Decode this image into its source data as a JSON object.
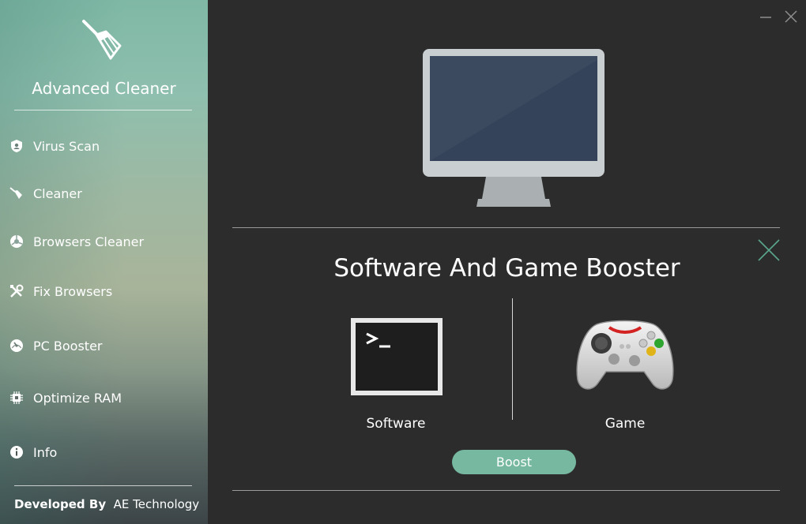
{
  "app": {
    "title": "Advanced Cleaner",
    "brand_icon": "broom-icon"
  },
  "sidebar": {
    "items": [
      {
        "label": "Virus Scan",
        "icon": "shield-icon"
      },
      {
        "label": "Cleaner",
        "icon": "broom-icon"
      },
      {
        "label": "Browsers Cleaner",
        "icon": "browser-icon"
      },
      {
        "label": "Fix Browsers",
        "icon": "tools-icon"
      },
      {
        "label": "PC Booster",
        "icon": "speedometer-icon"
      },
      {
        "label": "Optimize RAM",
        "icon": "chip-icon"
      },
      {
        "label": "Info",
        "icon": "info-icon"
      }
    ],
    "footer": {
      "prefix": "Developed By",
      "company": "AE Technology"
    }
  },
  "window": {
    "minimize_icon": "minimize-icon",
    "close_icon": "close-icon"
  },
  "panel": {
    "title": "Software And Game Booster",
    "options": [
      {
        "label": "Software",
        "icon": "terminal-icon"
      },
      {
        "label": "Game",
        "icon": "gamepad-icon"
      }
    ],
    "boost_label": "Boost",
    "close_icon": "close-icon"
  },
  "colors": {
    "accent": "#76b8a0",
    "background": "#2c2c2c",
    "monitor_frame": "#c9ced0",
    "monitor_screen": "#3b4a5e"
  }
}
